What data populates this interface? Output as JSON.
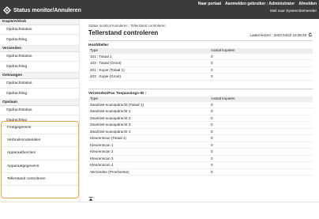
{
  "header": {
    "brand_title": "Status monitor/Annuleren",
    "links": [
      "Naar portaal",
      "Aanmelden gebruiker : Administrator",
      "Afmelden"
    ],
    "mail_label": "Mail naar Systeembeheerder"
  },
  "sidebar": {
    "groups": [
      {
        "heading": "Kopie/Afdruk",
        "items": [
          "Opdrachtstatus",
          "Opdrachtlog"
        ]
      },
      {
        "heading": "Verzenden",
        "items": [
          "Opdrachtstatus",
          "Opdrachtlog"
        ]
      },
      {
        "heading": "Ontvangen",
        "items": [
          "Opdrachtstatus",
          "Opdrachtlog"
        ]
      },
      {
        "heading": "Opslaan",
        "items": [
          "Opdrachtstatus",
          "Opdrachtlog"
        ]
      }
    ],
    "highlighted_items": [
      "Foutgegevens",
      "Verbruiksmaterialen",
      "Apparaatfuncties",
      "Apparaatgegevens",
      "Tellerstand controleren"
    ],
    "highlight_color": "#f0a44b"
  },
  "main": {
    "breadcrumb": "Status monitor/Annuleren : Tellerstand controleren",
    "title": "Tellerstand controleren",
    "last_updated": "Laatst leszen : 2022 04/22 23:39:28",
    "section1": {
      "title": "Hoofdteller",
      "headers": [
        "Type",
        "Aantal kopieën"
      ],
      "rows": [
        [
          "101 : Totaal 1",
          "0"
        ],
        [
          "103 : Totaal (Groot)",
          "0"
        ],
        [
          "201 : Kopie (Totaal 1)",
          "0"
        ],
        [
          "203 : Kopie (Groot)",
          "0"
        ]
      ]
    },
    "section2": {
      "title": "Verzenden/Fax Toepassings-ID :",
      "headers": [
        "Type",
        "Aantal kopieën"
      ],
      "rows": [
        [
          "Zwart/wit-scanopdracht (Totaal 1)",
          "0"
        ],
        [
          "Zwart/wit-scanopdracht 1",
          "0"
        ],
        [
          "Zwart/wit-scanopdracht 2",
          "0"
        ],
        [
          "Zwart/wit-scanopdracht 3",
          "0"
        ],
        [
          "Zwart/wit-scanopdracht 4",
          "0"
        ],
        [
          "Kleurenscan (Totaal 1)",
          "0"
        ],
        [
          "Kleurenscan 1",
          "0"
        ],
        [
          "Kleurenscan 2",
          "0"
        ],
        [
          "Kleurenscan 3",
          "0"
        ],
        [
          "Kleurenscan 4",
          "0"
        ],
        [
          "Verzenden (Proefversie)",
          "0"
        ]
      ]
    },
    "to_top_icon": "to-top-icon"
  }
}
